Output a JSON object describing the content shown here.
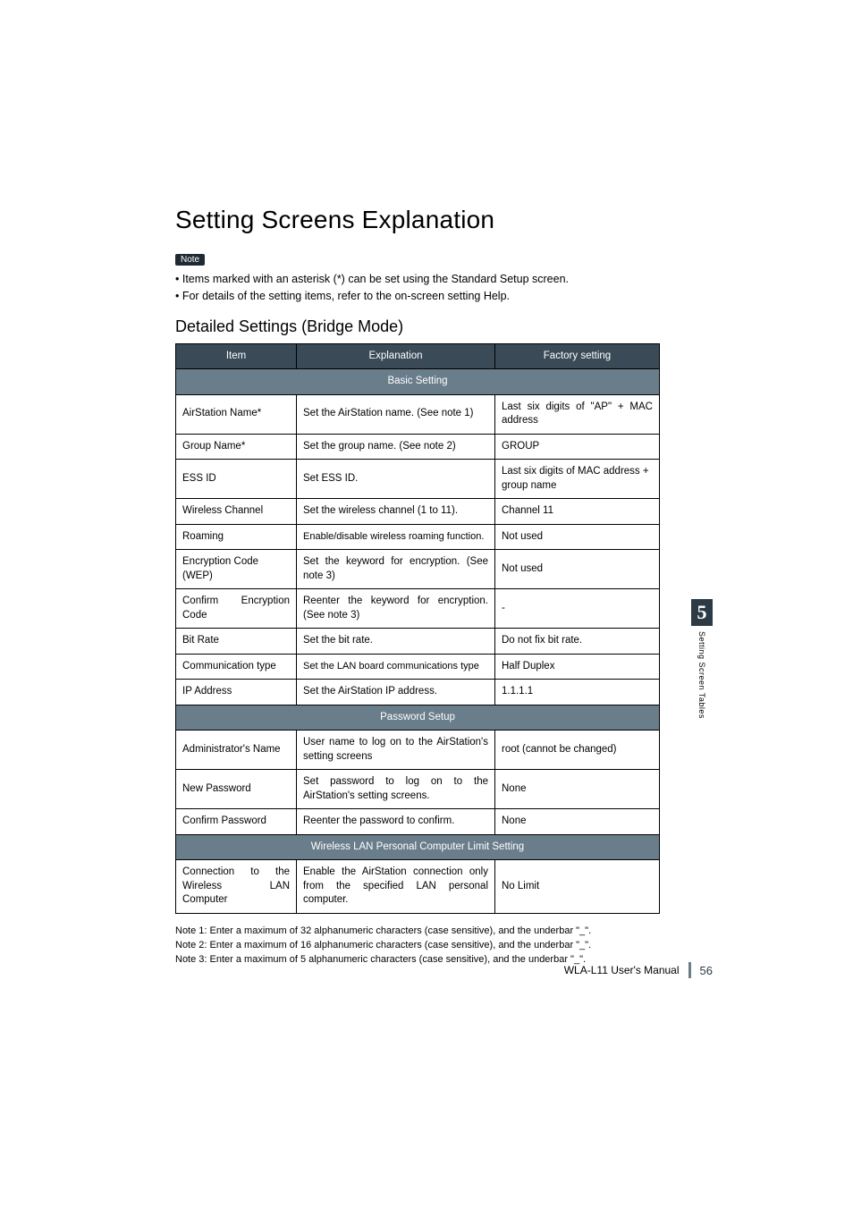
{
  "heading": "Setting Screens Explanation",
  "note_badge": "Note",
  "note_lines": [
    "• Items marked with an asterisk (*) can be set using the Standard Setup screen.",
    "• For details of the setting items, refer to the on-screen setting Help."
  ],
  "subheading": "Detailed Settings (Bridge Mode)",
  "table": {
    "headers": {
      "item": "Item",
      "explanation": "Explanation",
      "factory": "Factory setting"
    },
    "sections": [
      {
        "title": "Basic Setting",
        "rows": [
          {
            "item": "AirStation Name*",
            "explanation": "Set the AirStation name. (See note 1)",
            "factory": "Last six digits of \"AP\" + MAC address"
          },
          {
            "item": "Group Name*",
            "explanation": "Set the group name. (See note 2)",
            "factory": "GROUP"
          },
          {
            "item": "ESS ID",
            "explanation": "Set ESS ID.",
            "factory": "Last six digits of MAC address + group name"
          },
          {
            "item": "Wireless Channel",
            "explanation": "Set the wireless channel (1 to 11).",
            "factory": "Channel 11"
          },
          {
            "item": "Roaming",
            "explanation": "Enable/disable wireless roaming function.",
            "factory": "Not used"
          },
          {
            "item": "Encryption Code (WEP)",
            "explanation": "Set the keyword for encryption. (See note 3)",
            "factory": "Not used"
          },
          {
            "item": "Confirm Encryption Code",
            "explanation": "Reenter the keyword for encryption. (See note 3)",
            "factory": "-"
          },
          {
            "item": "Bit Rate",
            "explanation": "Set the bit rate.",
            "factory": "Do not fix bit rate."
          },
          {
            "item": "Communication type",
            "explanation": "Set the LAN board communications type",
            "factory": "Half Duplex"
          },
          {
            "item": "IP Address",
            "explanation": "Set the AirStation IP address.",
            "factory": "1.1.1.1"
          }
        ]
      },
      {
        "title": "Password Setup",
        "rows": [
          {
            "item": "Administrator's Name",
            "explanation": "User name to log on to the AirStation's setting screens",
            "factory": "root (cannot be changed)"
          },
          {
            "item": "New Password",
            "explanation": "Set password to log on to the AirStation's setting screens.",
            "factory": "None"
          },
          {
            "item": "Confirm Password",
            "explanation": "Reenter the password to confirm.",
            "factory": "None"
          }
        ]
      },
      {
        "title": "Wireless LAN Personal Computer Limit Setting",
        "rows": [
          {
            "item": "Connection to the Wireless LAN Computer",
            "explanation": "Enable the AirStation connection only from the specified LAN personal computer.",
            "factory": "No Limit"
          }
        ]
      }
    ]
  },
  "footnotes": [
    "Note 1: Enter a maximum of 32 alphanumeric characters (case sensitive), and the underbar \"_\".",
    "Note 2: Enter a maximum of 16 alphanumeric characters (case sensitive), and the underbar \"_\".",
    "Note 3: Enter a maximum of 5 alphanumeric characters (case sensitive), and the underbar \"_\"."
  ],
  "side_tab": {
    "chapter_number": "5",
    "chapter_label": "Setting Screen Tables"
  },
  "footer": {
    "manual": "WLA-L11 User's Manual",
    "page": "56"
  }
}
